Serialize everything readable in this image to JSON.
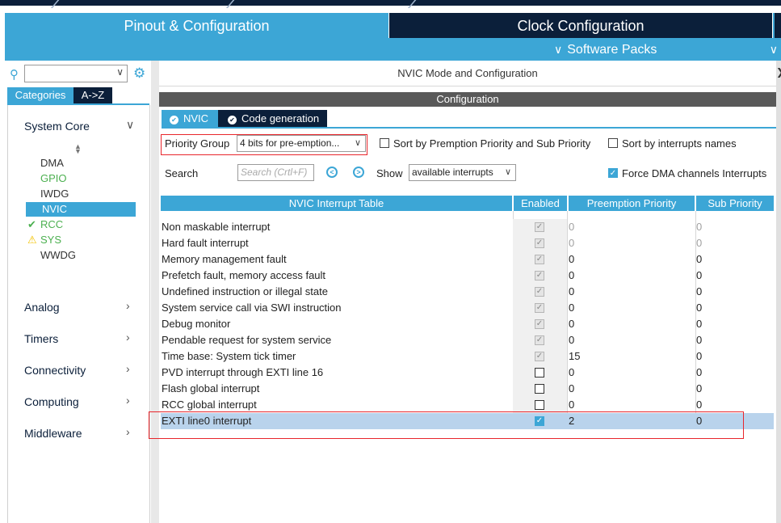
{
  "tabs": {
    "pinout": "Pinout & Configuration",
    "clock": "Clock Configuration",
    "software_packs": "Software Packs"
  },
  "sidebar": {
    "categories_tab": "Categories",
    "az_tab": "A->Z",
    "sections": [
      "System Core",
      "Analog",
      "Timers",
      "Connectivity",
      "Computing",
      "Middleware"
    ],
    "system_core_items": [
      {
        "label": "DMA",
        "state": "normal"
      },
      {
        "label": "GPIO",
        "state": "green"
      },
      {
        "label": "IWDG",
        "state": "normal"
      },
      {
        "label": "NVIC",
        "state": "selected"
      },
      {
        "label": "RCC",
        "state": "ok"
      },
      {
        "label": "SYS",
        "state": "warning"
      },
      {
        "label": "WWDG",
        "state": "normal"
      }
    ]
  },
  "panel": {
    "title": "NVIC Mode and Configuration",
    "config_header": "Configuration",
    "subtab_nvic": "NVIC",
    "subtab_codegen": "Code generation",
    "priority_group_label": "Priority Group",
    "priority_group_value": "4 bits for pre-emption...",
    "sort_premption": "Sort by Premption Priority and Sub Priority",
    "sort_names": "Sort by interrupts names",
    "search_label": "Search",
    "search_placeholder": "Search (Crtl+F)",
    "show_label": "Show",
    "show_value": "available interrupts",
    "force_dma": "Force DMA channels Interrupts"
  },
  "table": {
    "headers": [
      "NVIC Interrupt Table",
      "Enabled",
      "Preemption Priority",
      "Sub Priority"
    ],
    "rows": [
      {
        "name": "Non maskable interrupt",
        "enabled": "locked",
        "preemption": "0",
        "sub": "0"
      },
      {
        "name": "Hard fault interrupt",
        "enabled": "locked",
        "preemption": "0",
        "sub": "0"
      },
      {
        "name": "Memory management fault",
        "enabled": "locked",
        "preemption": "0",
        "sub": "0"
      },
      {
        "name": "Prefetch fault, memory access fault",
        "enabled": "locked",
        "preemption": "0",
        "sub": "0"
      },
      {
        "name": "Undefined instruction or illegal state",
        "enabled": "locked",
        "preemption": "0",
        "sub": "0"
      },
      {
        "name": "System service call via SWI instruction",
        "enabled": "locked",
        "preemption": "0",
        "sub": "0"
      },
      {
        "name": "Debug monitor",
        "enabled": "locked",
        "preemption": "0",
        "sub": "0"
      },
      {
        "name": "Pendable request for system service",
        "enabled": "locked",
        "preemption": "0",
        "sub": "0"
      },
      {
        "name": "Time base: System tick timer",
        "enabled": "locked",
        "preemption": "15",
        "sub": "0"
      },
      {
        "name": "PVD interrupt through EXTI line 16",
        "enabled": "off",
        "preemption": "0",
        "sub": "0"
      },
      {
        "name": "Flash global interrupt",
        "enabled": "off",
        "preemption": "0",
        "sub": "0"
      },
      {
        "name": "RCC global interrupt",
        "enabled": "off",
        "preemption": "0",
        "sub": "0"
      },
      {
        "name": "EXTI line0 interrupt",
        "enabled": "on",
        "preemption": "2",
        "sub": "0"
      }
    ]
  },
  "colors": {
    "accent": "#3ca6d6",
    "navy": "#0b1f3a",
    "highlight_outline": "#e8262c",
    "selected_row": "#b9d3ec"
  }
}
